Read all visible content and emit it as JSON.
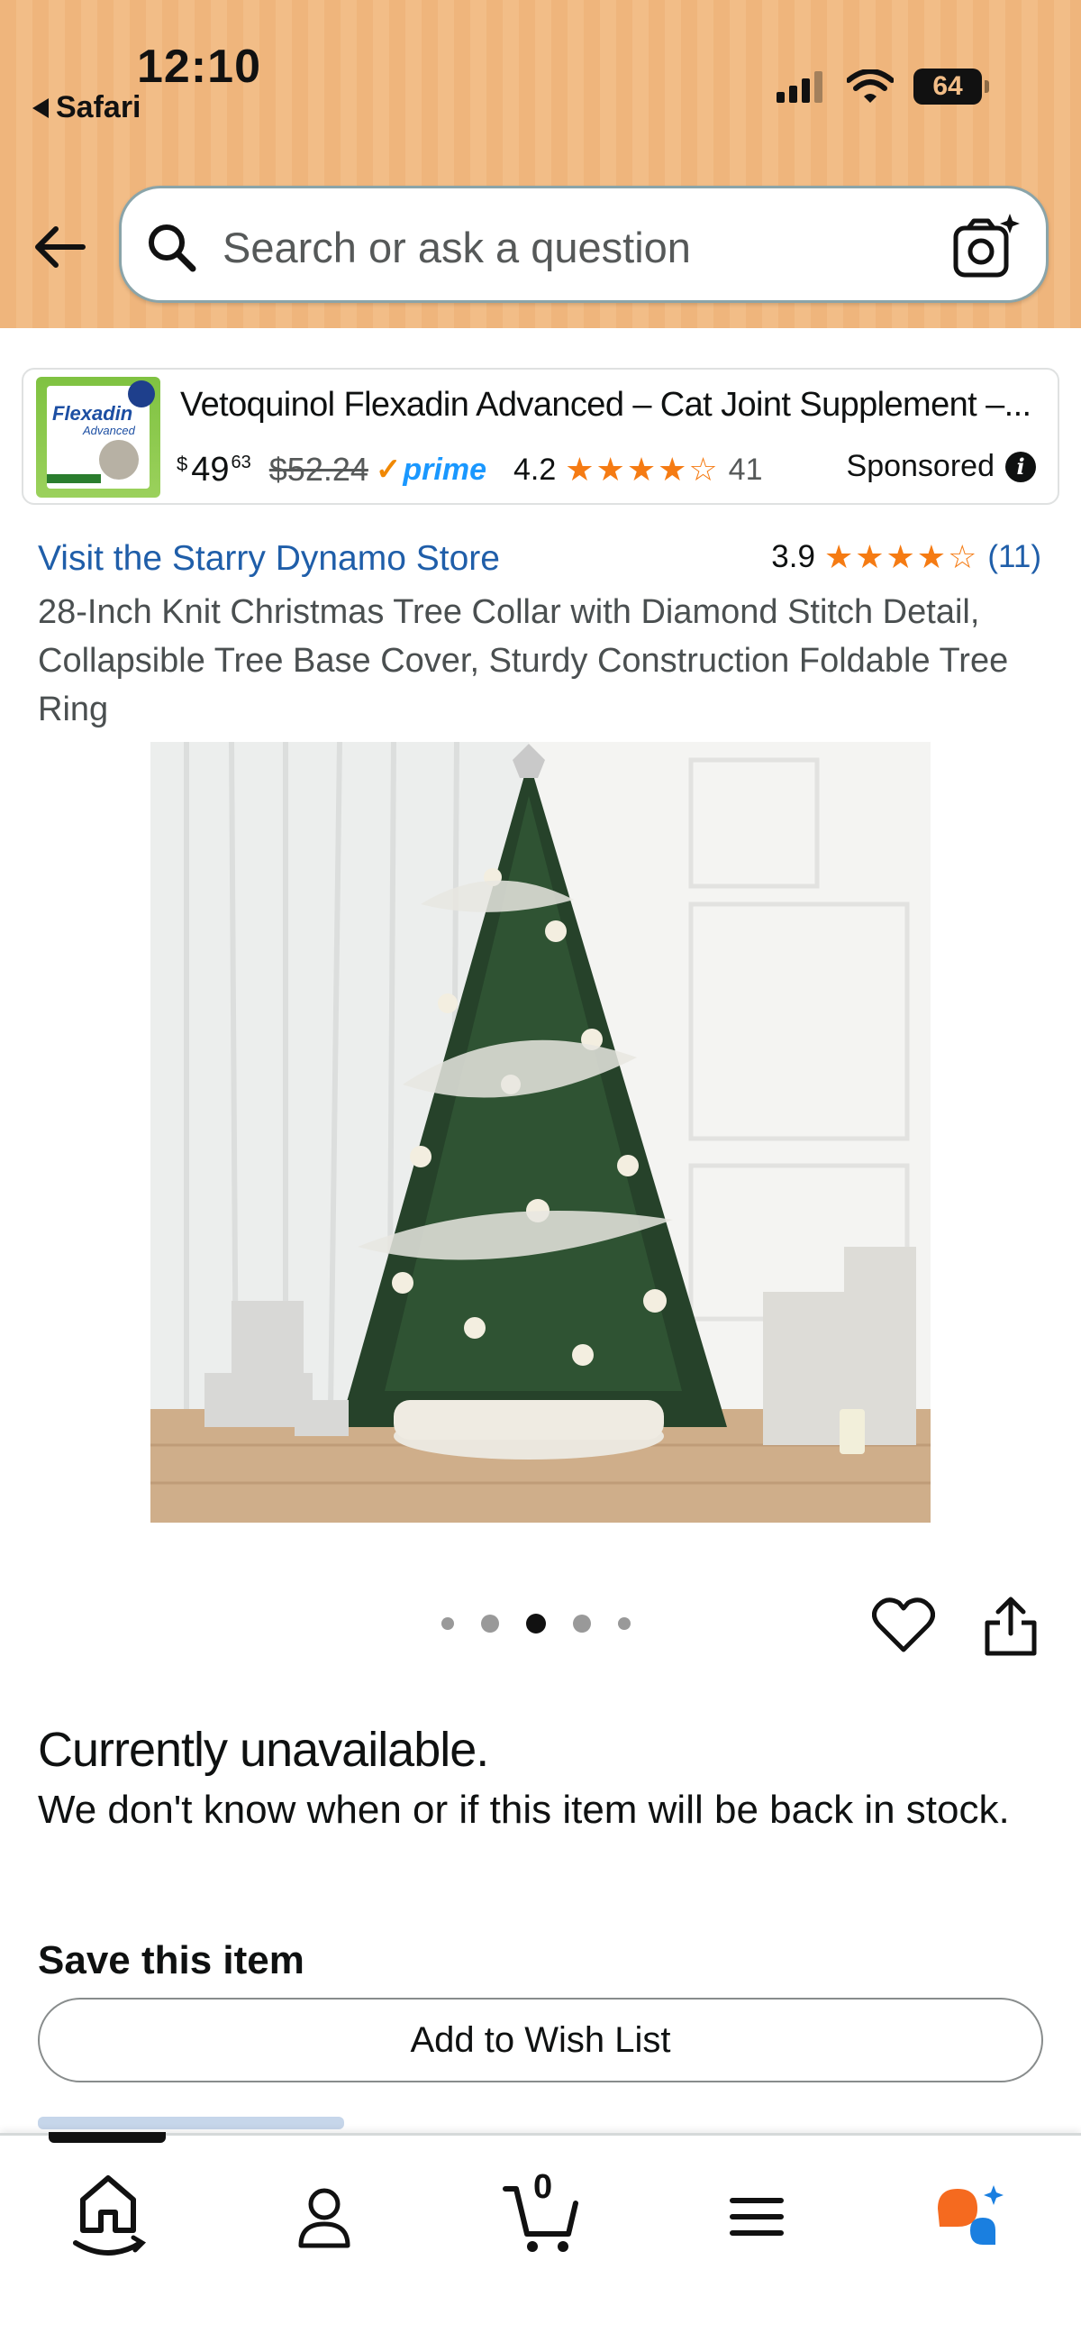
{
  "status_bar": {
    "time": "12:10",
    "back_app": "Safari",
    "battery": "64"
  },
  "search": {
    "placeholder": "Search or ask a question"
  },
  "sponsored_ad": {
    "title": "Vetoquinol Flexadin Advanced – Cat Joint Supplement –...",
    "thumb_brand": "Flexadin",
    "thumb_sub": "Advanced",
    "price_symbol": "$",
    "price_whole": "49",
    "price_fraction": "63",
    "list_price": "$52.24",
    "prime_label": "prime",
    "rating": "4.2",
    "stars": 4.2,
    "review_count": "41",
    "sponsored_label": "Sponsored",
    "accent_color": "#1a98ff"
  },
  "product": {
    "store_link": "Visit the Starry Dynamo Store",
    "rating": "3.9",
    "stars": 3.9,
    "review_count": "(11)",
    "title": "28-Inch Knit Christmas Tree Collar with Diamond Stitch Detail, Collapsible Tree Base Cover, Sturdy Construction Foldable Tree Ring",
    "image_icon": "christmas-tree-photo",
    "image_count": 5,
    "active_image": 3
  },
  "availability": {
    "headline": "Currently unavailable.",
    "detail": "We don't know when or if this item will be back in stock."
  },
  "save": {
    "label": "Save this item",
    "wishlist_button": "Add to Wish List"
  },
  "bottom_nav": {
    "items": [
      {
        "icon": "home-icon",
        "active": true
      },
      {
        "icon": "account-icon",
        "active": false
      },
      {
        "icon": "cart-icon",
        "active": false
      },
      {
        "icon": "menu-icon",
        "active": false
      },
      {
        "icon": "rufus-icon",
        "active": false
      }
    ],
    "cart_count": "0"
  },
  "colors": {
    "header_bg": "#efb57c",
    "link": "#1f5ea9",
    "star": "#f57b13",
    "prime_check": "#f08804"
  }
}
